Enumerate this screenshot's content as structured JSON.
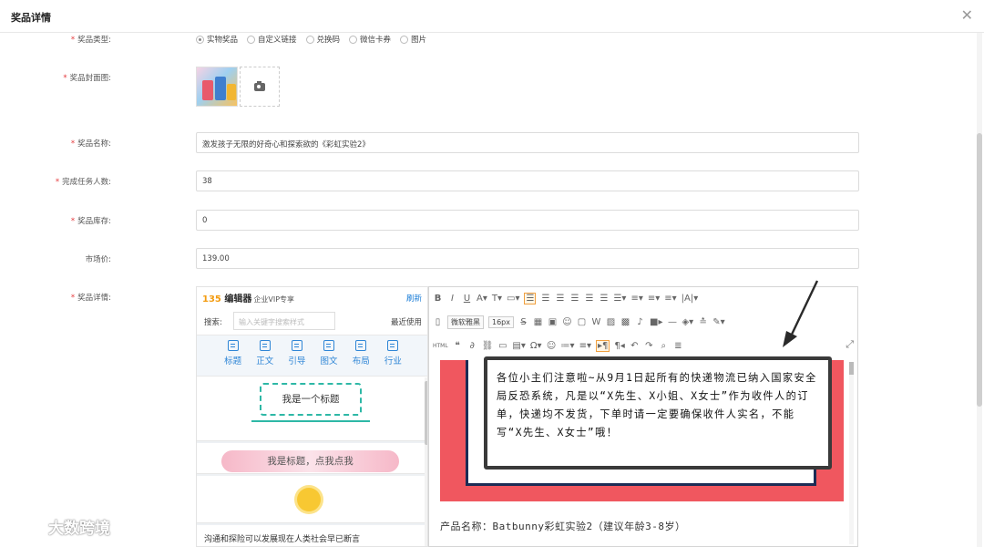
{
  "dialog": {
    "title": "奖品详情",
    "close_icon": "close-icon"
  },
  "form": {
    "prize_type": {
      "label": "奖品类型:",
      "options": [
        "实物奖品",
        "自定义链接",
        "兑换码",
        "微信卡券",
        "图片"
      ],
      "selected": "实物奖品"
    },
    "cover": {
      "label": "奖品封面图:"
    },
    "name": {
      "label": "奖品名称:",
      "value": "激发孩子无限的好奇心和探索欲的《彩虹实验2》"
    },
    "task_count": {
      "label": "完成任务人数:",
      "value": "38"
    },
    "stock": {
      "label": "奖品库存:",
      "value": "0"
    },
    "market_price": {
      "label": "市场价:",
      "value": "139.00"
    },
    "detail": {
      "label": "奖品详情:"
    }
  },
  "editor135": {
    "logo_num": "135",
    "logo_text": "编辑器",
    "logo_sub": "企业VIP专享",
    "refresh": "刷新",
    "search_label": "搜索:",
    "search_placeholder": "输入关键字搜索样式",
    "recent": "最近使用",
    "tabs": [
      "标题",
      "正文",
      "引导",
      "图文",
      "布局",
      "行业"
    ],
    "templates": {
      "t1": "我是一个标题",
      "t2": "我是标题，点我点我",
      "t4": "沟通和探险可以发展现在人类社会早已断言"
    }
  },
  "ueditor": {
    "font_family": "微软雅黑",
    "font_size": "16px",
    "notice": "各位小主们注意啦~从9月1日起所有的快递物流已纳入国家安全局反恐系统，凡是以“X先生、X小姐、X女士”作为收件人的订单，快递均不发货，下单时请一定要确保收件人实名，不能写“X先生、X女士”哦！",
    "product": "产品名称：Batbunny彩虹实验2（建议年龄3-8岁）"
  },
  "watermark": {
    "text": "大数跨境"
  }
}
